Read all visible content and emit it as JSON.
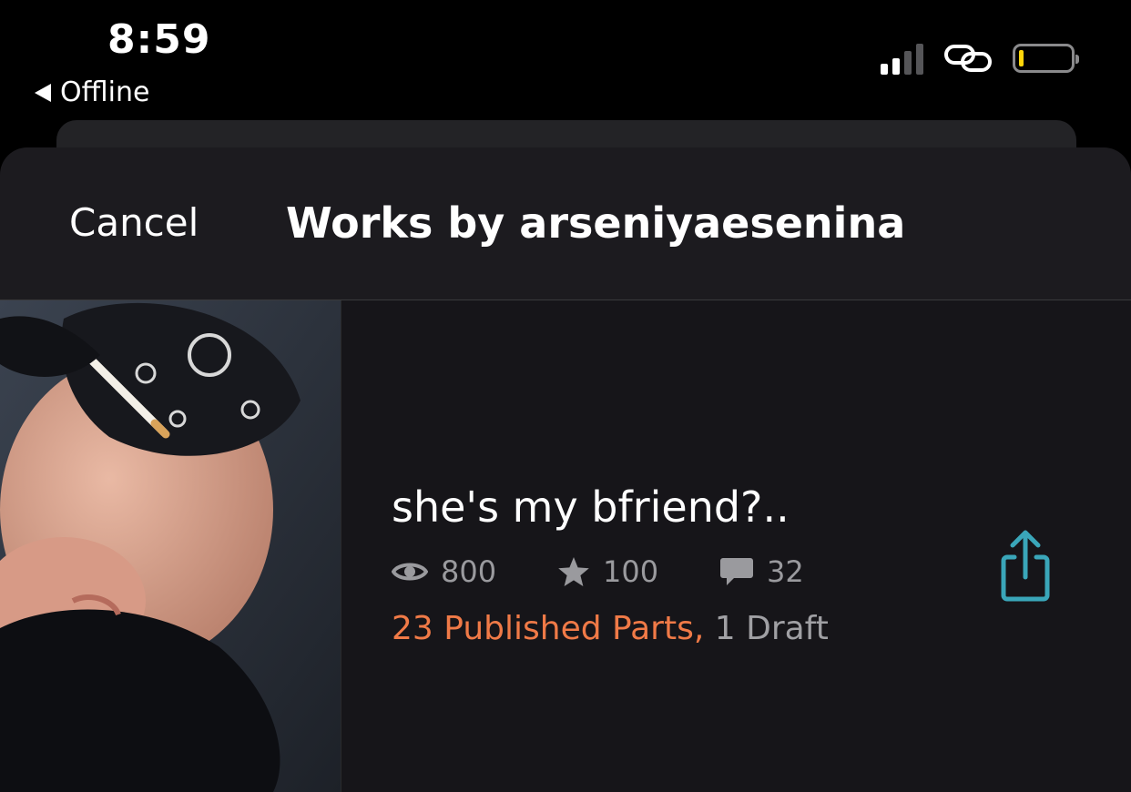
{
  "status_bar": {
    "time": "8:59",
    "back_app_label": "Offline",
    "battery_color": "#ffd60a"
  },
  "nav": {
    "cancel_label": "Cancel",
    "title": "Works by arseniyaesenina"
  },
  "story": {
    "title": "she's my bfriend?..",
    "reads": "800",
    "votes": "100",
    "comments": "32",
    "published_parts": "23 Published Parts,",
    "drafts": "1 Draft",
    "accent_color": "#f07a47",
    "share_icon_color": "#3aa6b9"
  }
}
